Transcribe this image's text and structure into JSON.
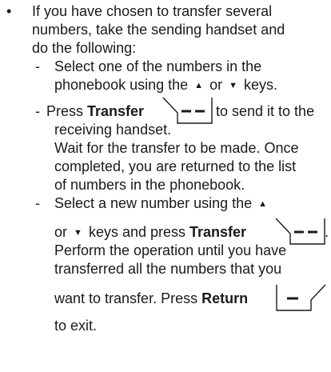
{
  "bullet": "•",
  "intro": {
    "line1": "If you have chosen to transfer several",
    "line2": "numbers, take the sending handset and",
    "line3": "do the following:"
  },
  "step1": {
    "dash": "-",
    "line1": "Select one of the numbers in the",
    "line2_pre": "phonebook using the",
    "or": "or",
    "line2_post": "keys."
  },
  "step2": {
    "dash": "-",
    "press": "Press",
    "transfer": "Transfer",
    "line1_post": "to send it to the",
    "line2": "receiving handset.",
    "line3": "Wait for the transfer to be made. Once",
    "line4": "completed, you are returned to the list",
    "line5": "of numbers in the phonebook."
  },
  "step3": {
    "dash": "-",
    "line1": "Select a new number using the",
    "or": "or",
    "line2_mid": "keys and press",
    "transfer": "Transfer",
    "line2_end": ".",
    "line3": "Perform the operation until you have",
    "line4": "transferred all the numbers that you",
    "line5_pre": "want to transfer. Press",
    "return": "Return",
    "line6": "to exit."
  },
  "icons": {
    "up": "up-arrow-icon",
    "down": "down-arrow-icon",
    "transfer_key": "transfer-softkey-icon",
    "return_key": "return-softkey-icon"
  }
}
